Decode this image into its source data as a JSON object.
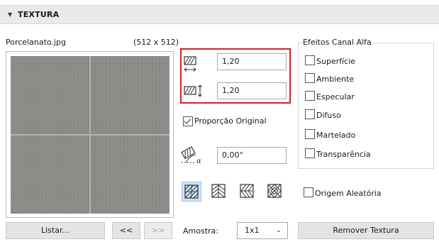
{
  "section": {
    "title": "TEXTURA"
  },
  "file": {
    "name": "Porcelanato.jpg",
    "size": "(512 x 512)"
  },
  "size_fields": {
    "width": "1,20",
    "height": "1,20"
  },
  "aspect": {
    "label": "Proporção Original",
    "checked": true
  },
  "angle": {
    "value": "0,00°"
  },
  "alpha": {
    "title": "Efeitos Canal Alfa",
    "items": [
      "Superfície",
      "Ambiente",
      "Especular",
      "Difuso",
      "Martelado",
      "Transparência"
    ]
  },
  "random_origin": {
    "label": "Origem Aleatória",
    "checked": false
  },
  "buttons": {
    "list": "Listar...",
    "prev": "<<",
    "next": ">>",
    "remove": "Remover Textura"
  },
  "sample": {
    "label": "Amostra:",
    "value": "1x1"
  },
  "colors": {
    "highlight": "#d32027",
    "selected_mode": "#cfe3f5"
  }
}
